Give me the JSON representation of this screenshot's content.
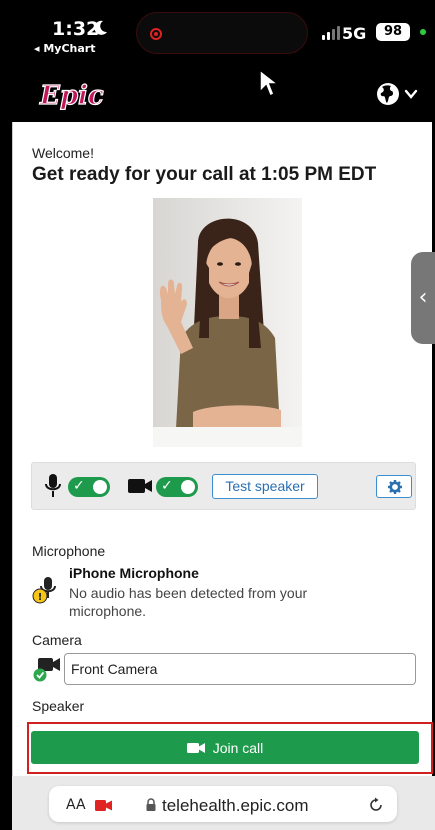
{
  "status_bar": {
    "time": "1:32",
    "back_app": "◂ MyChart",
    "network": "5G",
    "battery": "98"
  },
  "header": {
    "logo_text": "Epic",
    "brand_color": "#c2185b"
  },
  "page": {
    "welcome": "Welcome!",
    "title": "Get ready for your call at 1:05 PM EDT"
  },
  "controls": {
    "test_speaker_label": "Test speaker",
    "mic_on": true,
    "camera_on": true
  },
  "microphone": {
    "section_label": "Microphone",
    "device_name": "iPhone Microphone",
    "message": "No audio has been detected from your microphone."
  },
  "camera": {
    "section_label": "Camera",
    "selected": "Front Camera"
  },
  "speaker": {
    "section_label": "Speaker"
  },
  "join": {
    "label": "Join call",
    "color": "#1e9a4c"
  },
  "browser": {
    "aa_label": "AA",
    "url": "telehealth.epic.com"
  }
}
